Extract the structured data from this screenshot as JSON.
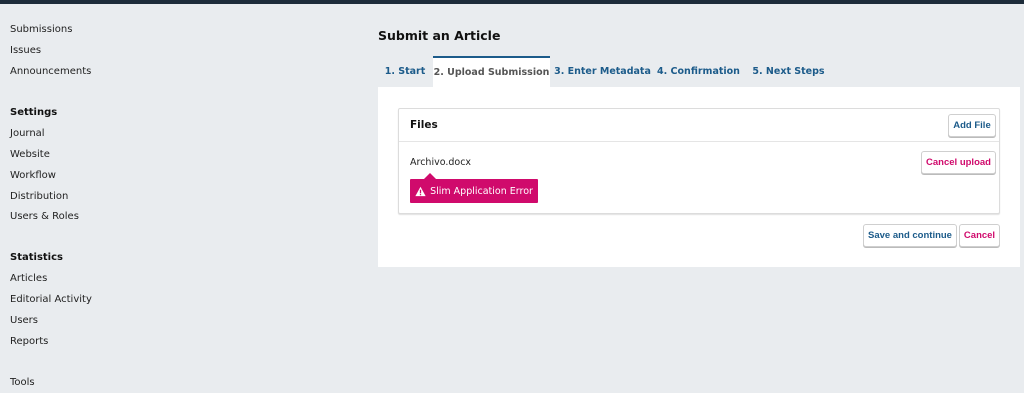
{
  "sidebar": {
    "items_top": [
      "Submissions",
      "Issues",
      "Announcements"
    ],
    "settings": {
      "heading": "Settings",
      "items": [
        "Journal",
        "Website",
        "Workflow",
        "Distribution",
        "Users & Roles"
      ]
    },
    "statistics": {
      "heading": "Statistics",
      "items": [
        "Articles",
        "Editorial Activity",
        "Users",
        "Reports"
      ]
    },
    "tools": "Tools"
  },
  "main": {
    "title": "Submit an Article",
    "tabs": [
      {
        "label": "1. Start",
        "active": false
      },
      {
        "label": "2. Upload Submission",
        "active": true
      },
      {
        "label": "3. Enter Metadata",
        "active": false
      },
      {
        "label": "4. Confirmation",
        "active": false
      },
      {
        "label": "5. Next Steps",
        "active": false
      }
    ],
    "files": {
      "title": "Files",
      "add_file_label": "Add File",
      "file_name": "Archivo.docx",
      "cancel_upload_label": "Cancel upload",
      "error_text": "Slim Application Error",
      "error_icon": "warning-triangle-icon"
    },
    "actions": {
      "save_continue_label": "Save and continue",
      "cancel_label": "Cancel"
    }
  },
  "colors": {
    "link_blue": "#1c5b8a",
    "accent_pink": "#d00a6c",
    "background": "#e9ecef",
    "topbar": "#1d2c3a"
  }
}
